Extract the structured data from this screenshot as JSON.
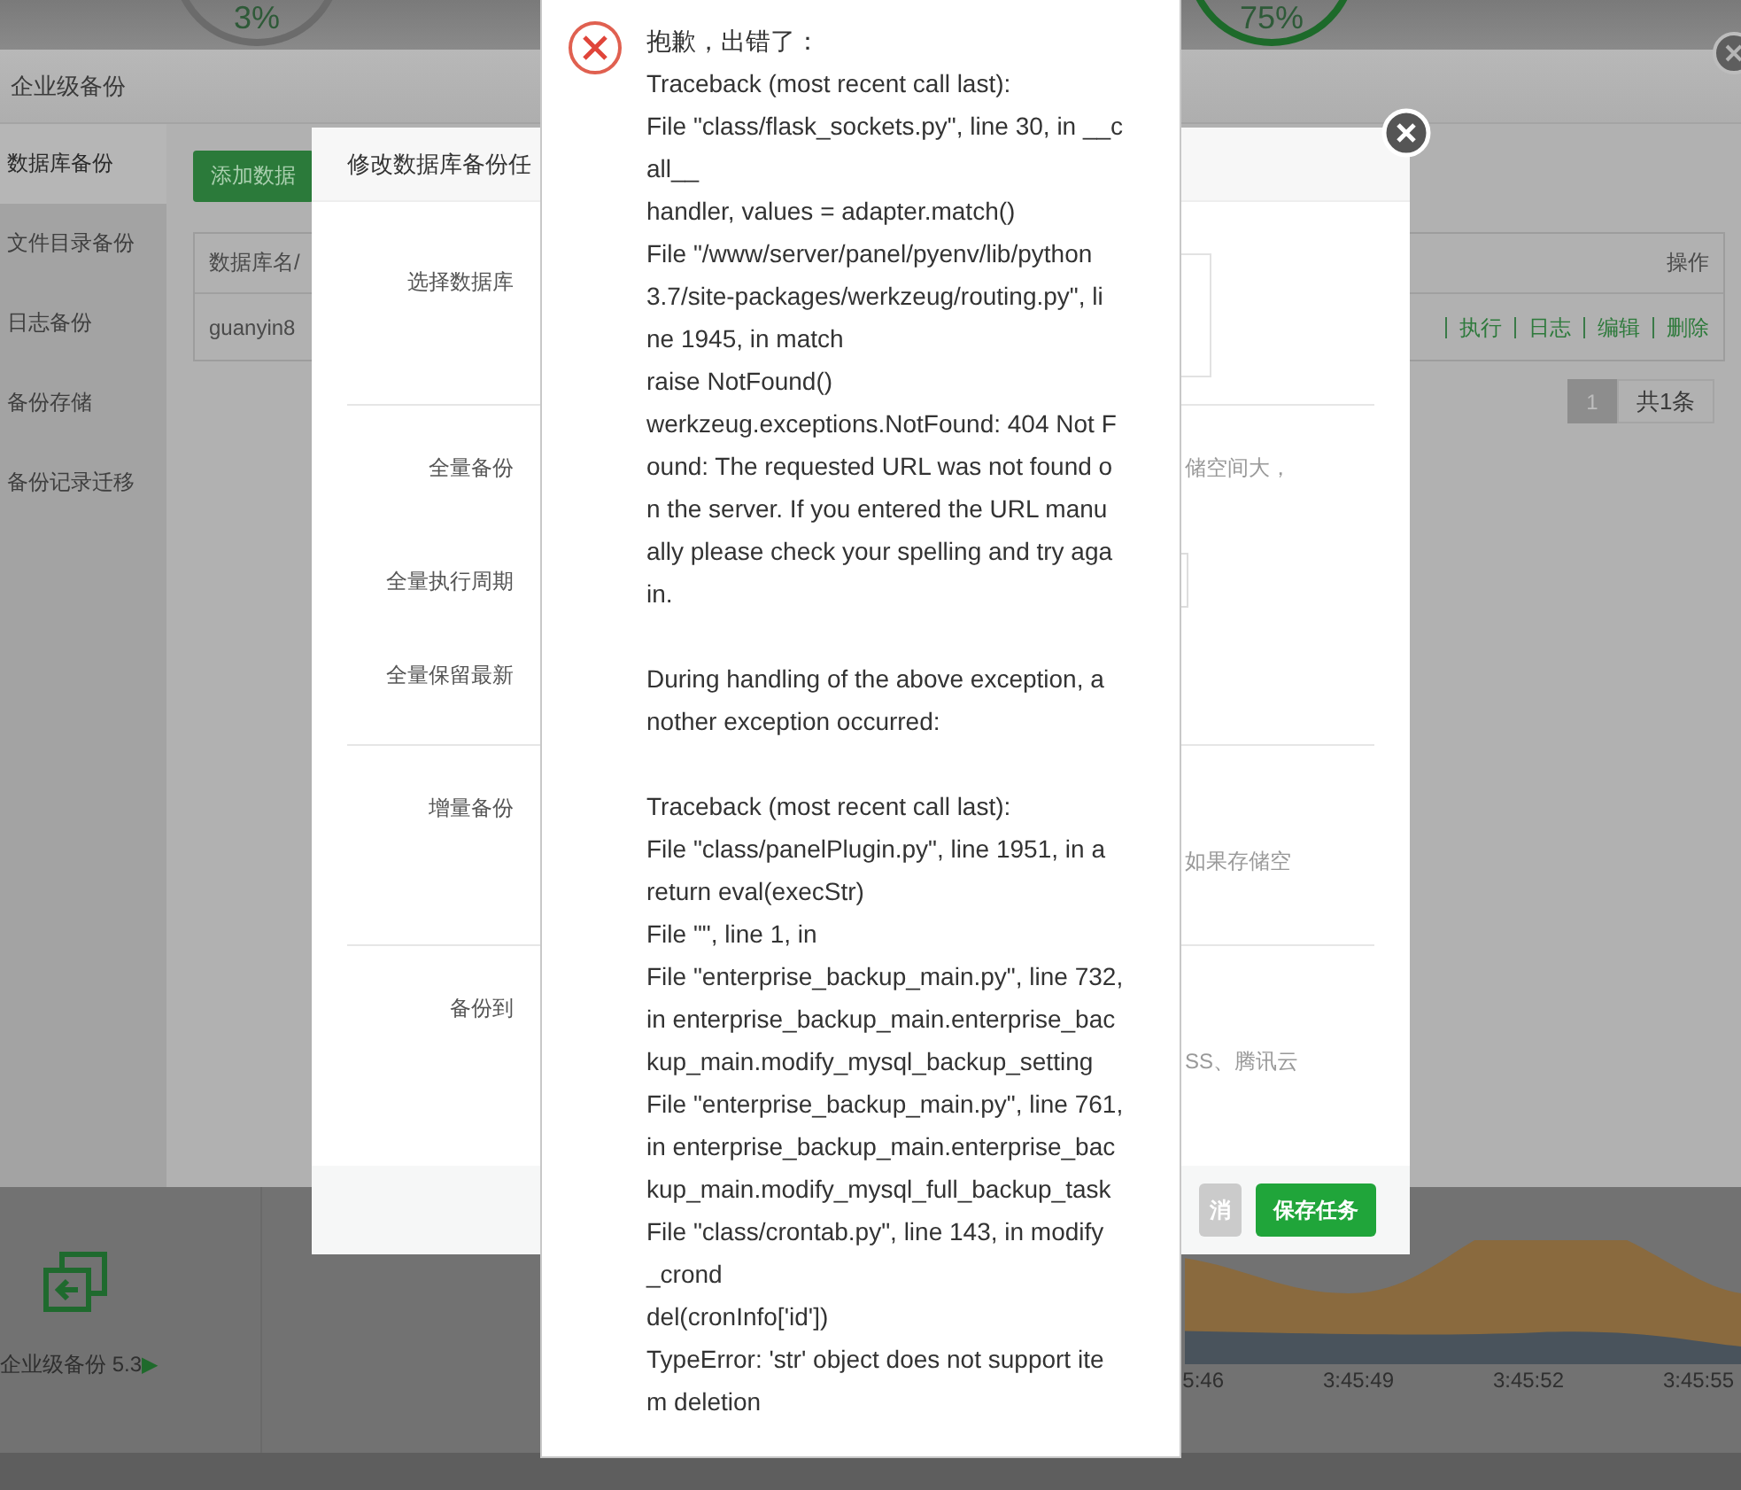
{
  "dashboard": {
    "gauges": [
      {
        "value": "3%",
        "color": "#6b6b6b"
      },
      {
        "value": "75%",
        "color": "#1d6a2a"
      }
    ],
    "plugin_card": {
      "label": "企业级备份 5.3",
      "arrow": "▶"
    },
    "chart_time_labels": [
      "5:46",
      "3:45:49",
      "3:45:52",
      "3:45:55"
    ]
  },
  "enterprise_window": {
    "title": "企业级备份",
    "sidebar": [
      {
        "label": "数据库备份",
        "selected": true
      },
      {
        "label": "文件目录备份",
        "selected": false
      },
      {
        "label": "日志备份",
        "selected": false
      },
      {
        "label": "备份存储",
        "selected": false
      },
      {
        "label": "备份记录迁移",
        "selected": false
      }
    ],
    "add_button": "添加数据",
    "table": {
      "columns": [
        "数据库名/",
        "操作"
      ],
      "rows": [
        {
          "name": "guanyin8",
          "actions": [
            "执行",
            "日志",
            "编辑",
            "删除"
          ]
        }
      ]
    },
    "pagination": {
      "pages": [
        {
          "label": "1",
          "selected": true
        }
      ],
      "total": "共1条"
    }
  },
  "edit_dialog": {
    "title": "修改数据库备份任",
    "sections": [
      {
        "rows": [
          {
            "kind": "select",
            "label": "选择数据库"
          }
        ]
      },
      {
        "rows": [
          {
            "kind": "inline_note",
            "label": "全量备份",
            "hint": "储空间大，"
          },
          {
            "kind": "input",
            "label": "全量执行周期"
          },
          {
            "kind": "plain",
            "label": "全量保留最新"
          }
        ]
      },
      {
        "rows": [
          {
            "kind": "note",
            "label": "增量备份",
            "hint": "如果存储空"
          }
        ]
      },
      {
        "rows": [
          {
            "kind": "note",
            "label": "备份到",
            "hint": "SS、腾讯云"
          }
        ]
      }
    ],
    "buttons": [
      {
        "kind": "cancel",
        "label": "消"
      },
      {
        "kind": "primary",
        "label": "保存任务"
      }
    ]
  },
  "error_popup": {
    "title": "抱歉，出错了：",
    "paragraphs": [
      [
        "Traceback (most recent call last):",
        "File \"class/flask_sockets.py\", line 30, in __c",
        "all__",
        "handler, values = adapter.match()",
        "File \"/www/server/panel/pyenv/lib/python",
        "3.7/site-packages/werkzeug/routing.py\", li",
        "ne 1945, in match",
        "raise NotFound()",
        "werkzeug.exceptions.NotFound: 404 Not F",
        "ound: The requested URL was not found o",
        "n the server. If you entered the URL manu",
        "ally please check your spelling and try aga",
        "in."
      ],
      [
        "During handling of the above exception, a",
        "nother exception occurred:"
      ],
      [
        "Traceback (most recent call last):",
        "File \"class/panelPlugin.py\", line 1951, in a",
        "return eval(execStr)",
        "File \"\", line 1, in",
        "File \"enterprise_backup_main.py\", line 732,",
        "in enterprise_backup_main.enterprise_bac",
        "kup_main.modify_mysql_backup_setting",
        "File \"enterprise_backup_main.py\", line 761,",
        "in enterprise_backup_main.enterprise_bac",
        "kup_main.modify_mysql_full_backup_task",
        "File \"class/crontab.py\", line 143, in modify",
        "_crond",
        "del(cronInfo['id'])",
        "TypeError: 'str' object does not support ite",
        "m deletion"
      ]
    ]
  }
}
